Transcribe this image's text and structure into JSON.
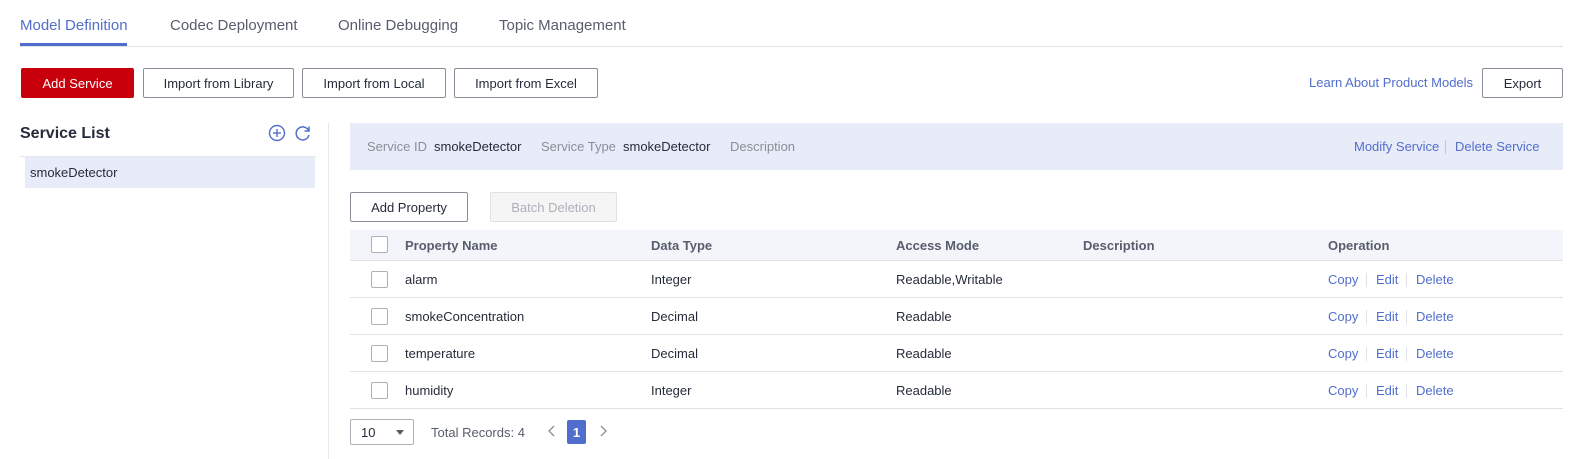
{
  "tabs": [
    {
      "label": "Model Definition",
      "active": true
    },
    {
      "label": "Codec Deployment",
      "active": false
    },
    {
      "label": "Online Debugging",
      "active": false
    },
    {
      "label": "Topic Management",
      "active": false
    }
  ],
  "toolbar": {
    "add_service": "Add Service",
    "import_library": "Import from Library",
    "import_local": "Import from Local",
    "import_excel": "Import from Excel",
    "learn_link": "Learn About Product Models",
    "export": "Export"
  },
  "service_list": {
    "title": "Service List",
    "add_icon": "plus-circle-icon",
    "refresh_icon": "refresh-icon",
    "items": [
      {
        "label": "smokeDetector",
        "selected": true
      }
    ]
  },
  "service_info": {
    "id_label": "Service ID",
    "id_value": "smokeDetector",
    "type_label": "Service Type",
    "type_value": "smokeDetector",
    "desc_label": "Description",
    "modify": "Modify Service",
    "delete": "Delete Service"
  },
  "property_actions": {
    "add": "Add Property",
    "batch_delete": "Batch Deletion"
  },
  "table": {
    "columns": [
      "Property Name",
      "Data Type",
      "Access Mode",
      "Description",
      "Operation"
    ],
    "rows": [
      {
        "name": "alarm",
        "type": "Integer",
        "access": "Readable,Writable",
        "desc": ""
      },
      {
        "name": "smokeConcentration",
        "type": "Decimal",
        "access": "Readable",
        "desc": ""
      },
      {
        "name": "temperature",
        "type": "Decimal",
        "access": "Readable",
        "desc": ""
      },
      {
        "name": "humidity",
        "type": "Integer",
        "access": "Readable",
        "desc": ""
      }
    ],
    "ops": {
      "copy": "Copy",
      "edit": "Edit",
      "delete": "Delete"
    }
  },
  "pagination": {
    "page_size": "10",
    "total": "Total Records: 4",
    "current_page": "1"
  },
  "colors": {
    "accent": "#526ecc",
    "primary_button": "#c7000b",
    "selected_bg": "#e8ecf8"
  }
}
